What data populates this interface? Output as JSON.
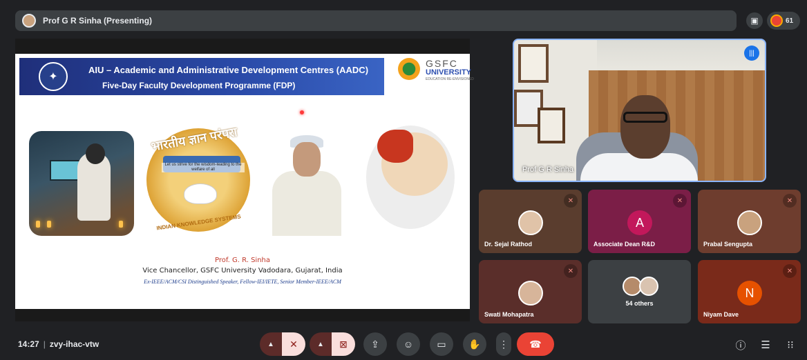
{
  "top_bar": {
    "presenting_label": "Prof G R Sinha (Presenting)",
    "participants_count": "61",
    "icons": [
      "presentation-off-icon",
      "people-icon"
    ]
  },
  "slide": {
    "header_line1": "AIU – Academic and Administrative Development Centres (AADC)",
    "header_line2": "Five-Day Faculty Development Programme (FDP)",
    "gsfc_name": "GSFC",
    "gsfc_university": "UNIVERSITY",
    "gsfc_tagline": "EDUCATION RE-ENVISIONED",
    "iks_hindi": "भारतीय ज्ञान परंपरा",
    "iks_motto": "Let us strive for the wisdom-leading to the welfare of all",
    "iks_bottom": "INDIAN KNOWLEDGE SYSTEMS",
    "speaker_name": "Prof. G. R. Sinha",
    "speaker_title": "Vice Chancellor, GSFC University Vadodara, Gujarat, India",
    "speaker_credentials": "Ex-IEEE/ACM/CSI Distinguished Speaker, Fellow-IEI/IETE, Senior Member-IEEE/ACM"
  },
  "presenter_tile": {
    "name": "Prof G R Sinha"
  },
  "participants": [
    {
      "name": "Dr. Sejal Rathod",
      "type": "photo",
      "bg": "#5a3d2e",
      "muted": true
    },
    {
      "name": "Associate Dean R&D",
      "type": "letter",
      "letter": "A",
      "bg": "#7b1e47",
      "avatar_color": "#c2185b",
      "muted": true
    },
    {
      "name": "Prabal Sengupta",
      "type": "photo",
      "bg": "#6e3d2e",
      "muted": true
    },
    {
      "name": "Swati Mohapatra",
      "type": "photo",
      "bg": "#5a2e2a",
      "muted": true
    },
    {
      "name": "54 others",
      "type": "group",
      "bg": "#3c4043",
      "muted": false
    },
    {
      "name": "Niyam Dave",
      "type": "letter",
      "letter": "N",
      "bg": "#7a2a1a",
      "avatar_color": "#e65100",
      "muted": true
    }
  ],
  "bottom_bar": {
    "time": "14:27",
    "meeting_code": "zvy-ihac-vtw",
    "controls": [
      "mic-options",
      "mic-off",
      "camera-options",
      "camera-off",
      "present-screen",
      "emoji-reactions",
      "captions",
      "raise-hand",
      "more-options",
      "leave-call"
    ],
    "right_controls": [
      "meeting-details",
      "chat",
      "activities"
    ]
  },
  "colors": {
    "background": "#202124",
    "accent_blue": "#8ab4f8",
    "end_call": "#ea4335",
    "muted_red": "#f28b82"
  }
}
